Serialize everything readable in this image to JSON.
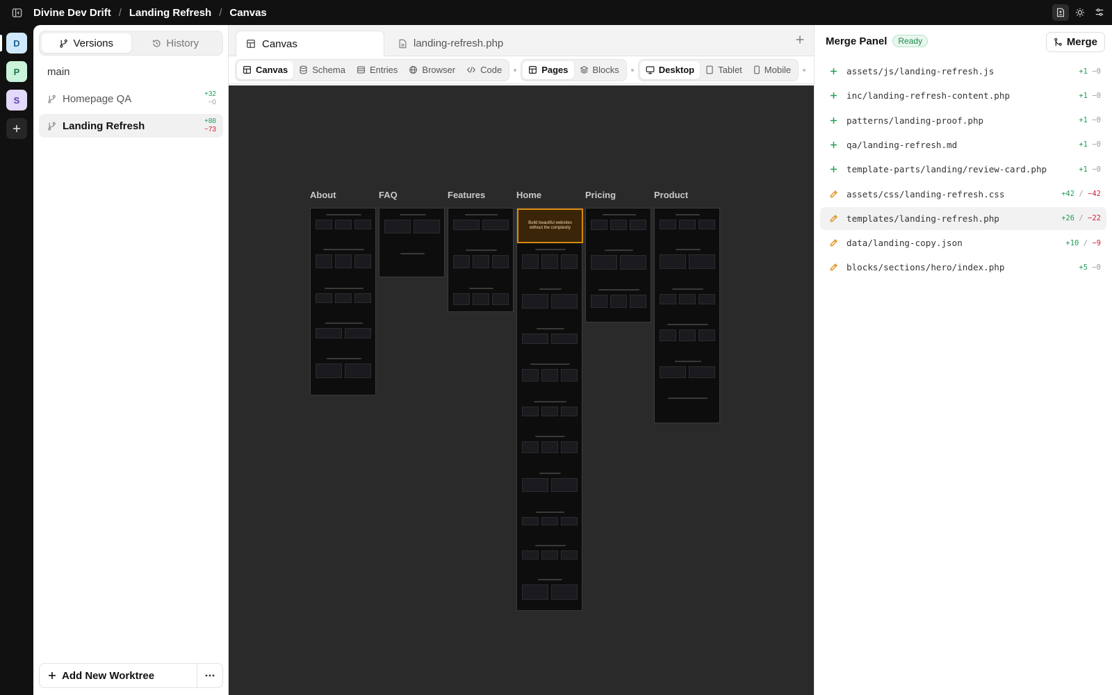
{
  "breadcrumb": [
    "Divine Dev Drift",
    "Landing Refresh",
    "Canvas"
  ],
  "workspaces": [
    {
      "letter": "D",
      "bg": "#cfe8fb",
      "fg": "#1a5f94"
    },
    {
      "letter": "P",
      "bg": "#c9f3da",
      "fg": "#1d7a45"
    },
    {
      "letter": "S",
      "bg": "#e2d9fb",
      "fg": "#5a3bb3"
    }
  ],
  "left_panel": {
    "tabs": [
      {
        "label": "Versions",
        "icon": "git-branch-icon"
      },
      {
        "label": "History",
        "icon": "history-icon"
      }
    ],
    "main_label": "main",
    "branches": [
      {
        "name": "Homepage QA",
        "added": "+32",
        "removed": "−0"
      },
      {
        "name": "Landing Refresh",
        "added": "+88",
        "removed": "−73"
      }
    ],
    "add_worktree_label": "Add New Worktree"
  },
  "doc_tabs": [
    {
      "label": "Canvas",
      "icon": "layout-icon"
    },
    {
      "label": "landing-refresh.php",
      "icon": "file-icon"
    }
  ],
  "toolbar": {
    "views": [
      "Canvas",
      "Schema",
      "Entries",
      "Browser",
      "Code"
    ],
    "modes": [
      "Pages",
      "Blocks"
    ],
    "devices": [
      "Desktop",
      "Tablet",
      "Mobile"
    ]
  },
  "canvas": {
    "pages": [
      {
        "label": "About",
        "length": 0.27
      },
      {
        "label": "FAQ",
        "length": 0.1
      },
      {
        "label": "Features",
        "length": 0.15
      },
      {
        "label": "Home",
        "length": 0.58
      },
      {
        "label": "Pricing",
        "length": 0.165
      },
      {
        "label": "Product",
        "length": 0.31
      }
    ],
    "home_hero_text": [
      "Build beautiful websites",
      "without the complexity"
    ]
  },
  "merge_panel": {
    "title": "Merge Panel",
    "status": "Ready",
    "merge_label": "Merge",
    "files": [
      {
        "path": "assets/js/landing-refresh.js",
        "type": "added",
        "added": "+1",
        "removed": "−0"
      },
      {
        "path": "inc/landing-refresh-content.php",
        "type": "added",
        "added": "+1",
        "removed": "−0"
      },
      {
        "path": "patterns/landing-proof.php",
        "type": "added",
        "added": "+1",
        "removed": "−0"
      },
      {
        "path": "qa/landing-refresh.md",
        "type": "added",
        "added": "+1",
        "removed": "−0"
      },
      {
        "path": "template-parts/landing/review-card.php",
        "type": "added",
        "added": "+1",
        "removed": "−0"
      },
      {
        "path": "assets/css/landing-refresh.css",
        "type": "modified",
        "added": "+42",
        "removed": "−42"
      },
      {
        "path": "templates/landing-refresh.php",
        "type": "modified",
        "added": "+26",
        "removed": "−22"
      },
      {
        "path": "data/landing-copy.json",
        "type": "modified",
        "added": "+10",
        "removed": "−9"
      },
      {
        "path": "blocks/sections/hero/index.php",
        "type": "modified",
        "added": "+5",
        "removed": "−0"
      }
    ]
  }
}
